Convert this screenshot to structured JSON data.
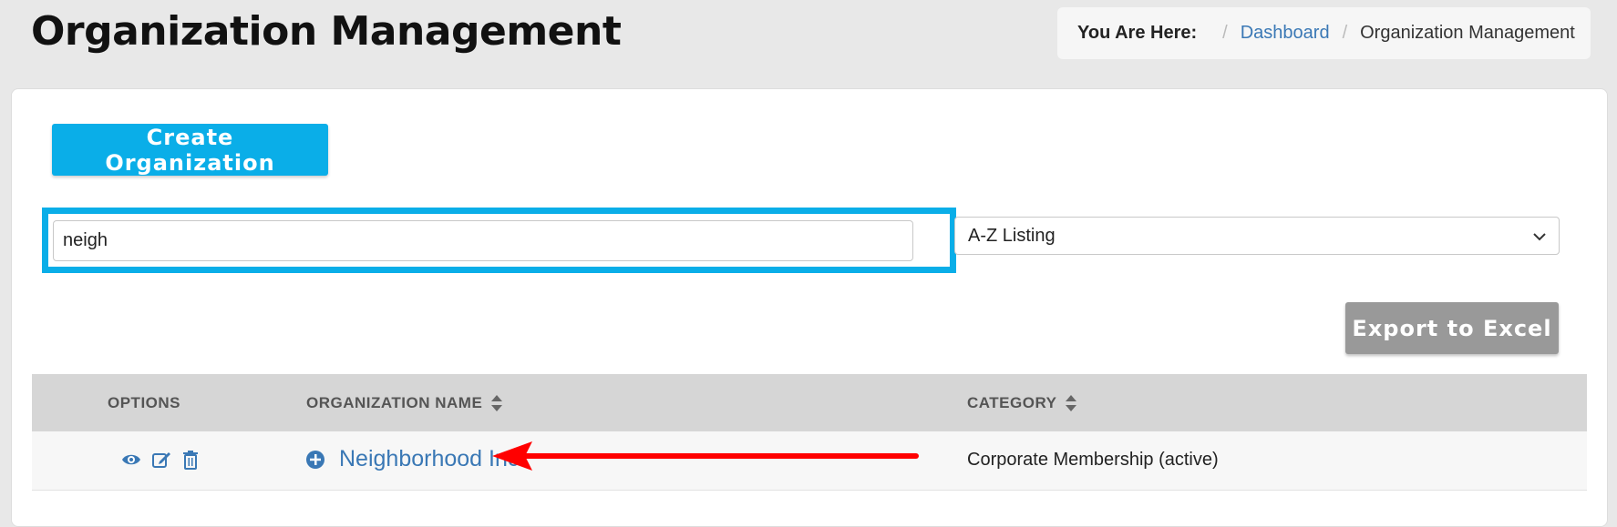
{
  "page": {
    "title": "Organization Management"
  },
  "breadcrumb": {
    "label": "You Are Here:",
    "items": [
      "Dashboard",
      "Organization Management"
    ],
    "separator": "/"
  },
  "toolbar": {
    "create_label": "Create Organization",
    "export_label": "Export to Excel"
  },
  "search": {
    "value": "neigh"
  },
  "sort": {
    "selected": "A-Z Listing"
  },
  "table": {
    "columns": [
      "OPTIONS",
      "ORGANIZATION NAME",
      "CATEGORY"
    ],
    "rows": [
      {
        "name": "Neighborhood Inc.",
        "category": "Corporate Membership (active)"
      }
    ]
  },
  "colors": {
    "accent": "#0aaee8",
    "link": "#3a78b5",
    "export_button": "#999999",
    "annotation_arrow": "#ff0000"
  }
}
